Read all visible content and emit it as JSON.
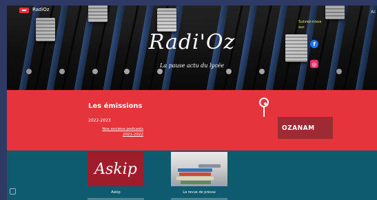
{
  "header": {
    "brand_small": "RadiOz",
    "site_title": "Radi'Oz",
    "tagline": "La pause actu du lycée",
    "follow_text": "Suivez-nous sur",
    "right_edge": "Ac"
  },
  "social": [
    {
      "name": "facebook",
      "glyph": "f"
    },
    {
      "name": "instagram",
      "glyph": "◎"
    }
  ],
  "emissions": {
    "title": "Les émissions",
    "year": "2022-2023",
    "link_1": "Nos anciens podcasts",
    "link_2": "2021-2022"
  },
  "school": {
    "name": "OZANAM"
  },
  "cards": [
    {
      "title": "Askip",
      "image_text": "Askip"
    },
    {
      "title": "La revue de presse"
    }
  ],
  "colors": {
    "accent_red": "#e6343d",
    "dark_red": "#9e2a33",
    "teal": "#0e5a6e",
    "follow_yellow": "#f3ff52",
    "facebook_blue": "#1877f2",
    "instagram_pink": "#e1306c"
  }
}
